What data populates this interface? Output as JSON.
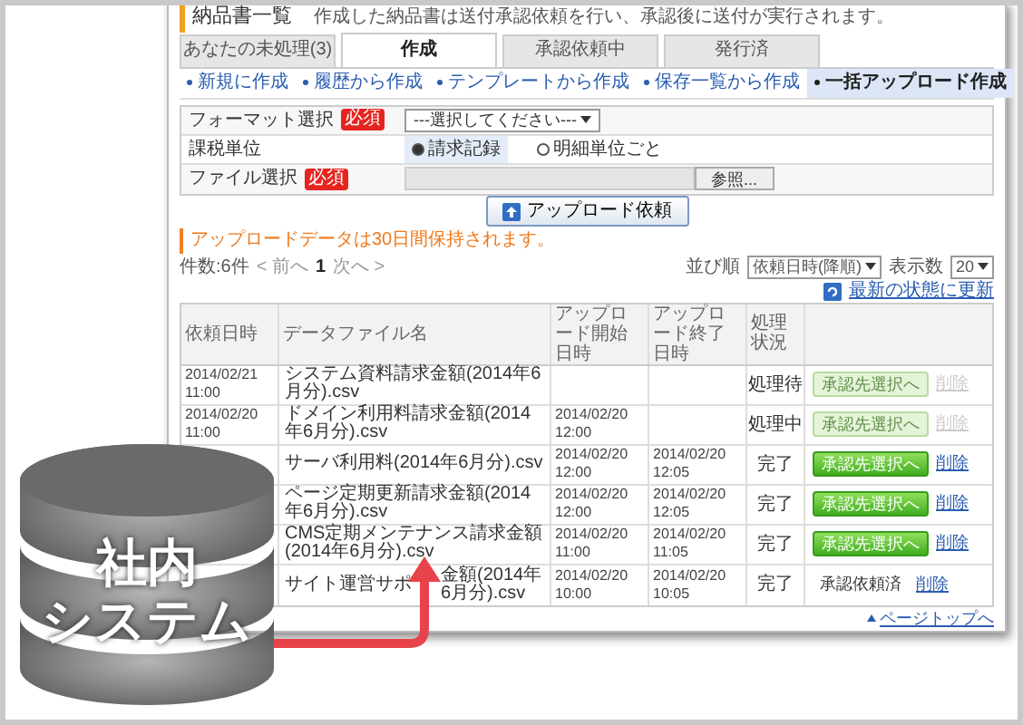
{
  "header": {
    "title": "納品書一覧",
    "description": "作成した納品書は送付承認依頼を行い、承認後に送付が実行されます。"
  },
  "tabs": [
    {
      "label": "あなたの未処理(3)",
      "selected": false
    },
    {
      "label": "作成",
      "selected": true
    },
    {
      "label": "承認依頼中",
      "selected": false
    },
    {
      "label": "発行済",
      "selected": false
    }
  ],
  "sub_tabs": [
    {
      "label": "新規に作成",
      "selected": false
    },
    {
      "label": "履歴から作成",
      "selected": false
    },
    {
      "label": "テンプレートから作成",
      "selected": false
    },
    {
      "label": "保存一覧から作成",
      "selected": false
    },
    {
      "label": "一括アップロード作成",
      "selected": true
    }
  ],
  "form": {
    "format": {
      "label": "フォーマット選択",
      "required": "必須",
      "value": "---選択してください---"
    },
    "unit": {
      "label": "課税単位",
      "options": [
        {
          "label": "請求記録",
          "selected": true
        },
        {
          "label": "明細単位ごと",
          "selected": false
        }
      ]
    },
    "file": {
      "label": "ファイル選択",
      "required": "必須",
      "browse": "参照..."
    },
    "submit": "アップロード依頼"
  },
  "note": "アップロードデータは30日間保持されます。",
  "pager": {
    "count": "件数:6件",
    "prev": "< 前へ",
    "page": "1",
    "next": "次へ >",
    "sort_label": "並び順",
    "sort_value": "依頼日時(降順)",
    "per_page_label": "表示数",
    "per_page_value": "20"
  },
  "refresh_link": "最新の状態に更新",
  "table": {
    "columns": [
      "依頼日時",
      "データファイル名",
      "アップロード開始日時",
      "アップロード終了日時",
      "処理状況"
    ],
    "rows": [
      {
        "date": "2014/02/21 11:00",
        "file": "システム資料請求金額(2014年6月分).csv",
        "status": "処理待",
        "action": {
          "kind": "button",
          "label": "承認先選択へ",
          "disabled": true
        },
        "delete": {
          "label": "削除",
          "disabled": true
        }
      },
      {
        "date": "2014/02/20 11:00",
        "file": "ドメイン利用料請求金額(2014年6月分).csv",
        "start": "2014/02/20 12:00",
        "status": "処理中",
        "action": {
          "kind": "button",
          "label": "承認先選択へ",
          "disabled": true
        },
        "delete": {
          "label": "削除",
          "disabled": true
        }
      },
      {
        "file": "サーバ利用料(2014年6月分).csv",
        "start": "2014/02/20 12:00",
        "end": "2014/02/20 12:05",
        "status": "完了",
        "action": {
          "kind": "button",
          "label": "承認先選択へ",
          "disabled": false
        },
        "delete": {
          "label": "削除",
          "disabled": false
        }
      },
      {
        "file": "ページ定期更新請求金額(2014年6月分).csv",
        "start": "2014/02/20 12:00",
        "end": "2014/02/20 12:05",
        "status": "完了",
        "action": {
          "kind": "button",
          "label": "承認先選択へ",
          "disabled": false
        },
        "delete": {
          "label": "削除",
          "disabled": false
        }
      },
      {
        "file": "CMS定期メンテナンス請求金額(2014年6月分).csv",
        "start": "2014/02/20 11:00",
        "end": "2014/02/20 11:05",
        "status": "完了",
        "action": {
          "kind": "button",
          "label": "承認先選択へ",
          "disabled": false
        },
        "delete": {
          "label": "削除",
          "disabled": false
        }
      },
      {
        "file": "サイト運営サポ",
        "file_end": "金額(2014年6月分).csv",
        "start": "2014/02/20 10:00",
        "end": "2014/02/20 10:05",
        "status": "完了",
        "action": {
          "kind": "text",
          "label": "承認依頼済"
        },
        "delete": {
          "label": "削除",
          "disabled": false
        }
      }
    ]
  },
  "page_top_link": "ページトップへ",
  "database": {
    "lines": [
      "社内",
      "システム"
    ]
  }
}
